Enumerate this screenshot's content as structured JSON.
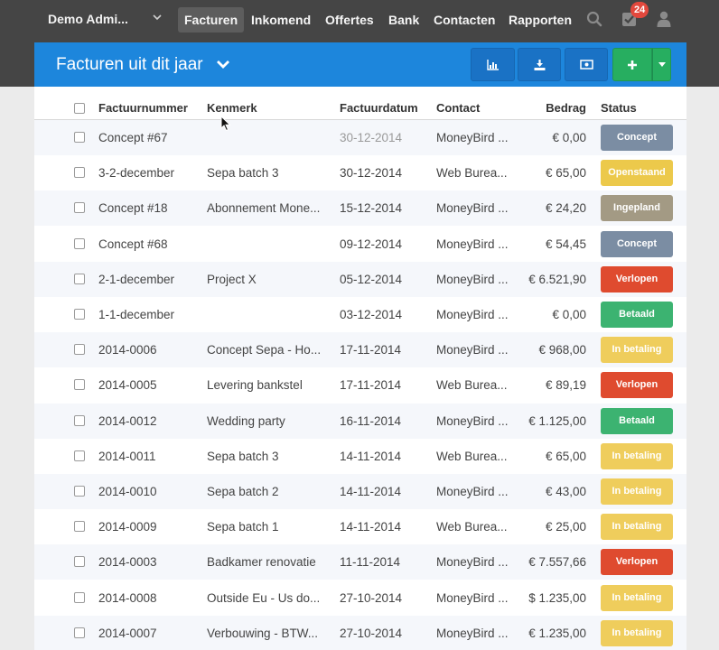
{
  "nav": {
    "admin_label": "Demo Admi...",
    "items": [
      {
        "label": "Facturen",
        "active": true
      },
      {
        "label": "Inkomend"
      },
      {
        "label": "Offertes"
      },
      {
        "label": "Bank"
      },
      {
        "label": "Contacten"
      },
      {
        "label": "Rapporten"
      }
    ],
    "notification_count": "24",
    "icons": [
      "search-icon",
      "check-square-icon",
      "user-icon"
    ]
  },
  "panel": {
    "title": "Facturen uit dit jaar",
    "toolbar_icons": [
      "chart-icon",
      "download-icon",
      "money-icon",
      "plus-icon",
      "caret-down-icon"
    ]
  },
  "table": {
    "headers": [
      "Factuurnummer",
      "Kenmerk",
      "Factuurdatum",
      "Contact",
      "Bedrag",
      "Status"
    ],
    "rows": [
      {
        "number": "Concept #67",
        "reference": "",
        "date": "30-12-2014",
        "contact": "MoneyBird ...",
        "amount": "€ 0,00",
        "status": "Concept"
      },
      {
        "number": "3-2-december",
        "reference": "Sepa batch 3",
        "date": "30-12-2014",
        "contact": "Web Burea...",
        "amount": "€ 65,00",
        "status": "Openstaand"
      },
      {
        "number": "Concept #18",
        "reference": "Abonnement Mone...",
        "date": "15-12-2014",
        "contact": "MoneyBird ...",
        "amount": "€ 24,20",
        "status": "Ingepland"
      },
      {
        "number": "Concept #68",
        "reference": "",
        "date": "09-12-2014",
        "contact": "MoneyBird ...",
        "amount": "€ 54,45",
        "status": "Concept"
      },
      {
        "number": "2-1-december",
        "reference": "Project X",
        "date": "05-12-2014",
        "contact": "MoneyBird ...",
        "amount": "€ 6.521,90",
        "status": "Verlopen"
      },
      {
        "number": "1-1-december",
        "reference": "",
        "date": "03-12-2014",
        "contact": "MoneyBird ...",
        "amount": "€ 0,00",
        "status": "Betaald"
      },
      {
        "number": "2014-0006",
        "reference": "Concept Sepa - Ho...",
        "date": "17-11-2014",
        "contact": "MoneyBird ...",
        "amount": "€ 968,00",
        "status": "In betaling"
      },
      {
        "number": "2014-0005",
        "reference": "Levering bankstel",
        "date": "17-11-2014",
        "contact": "Web Burea...",
        "amount": "€ 89,19",
        "status": "Verlopen"
      },
      {
        "number": "2014-0012",
        "reference": "Wedding party",
        "date": "16-11-2014",
        "contact": "MoneyBird ...",
        "amount": "€ 1.125,00",
        "status": "Betaald"
      },
      {
        "number": "2014-0011",
        "reference": "Sepa batch 3",
        "date": "14-11-2014",
        "contact": "Web Burea...",
        "amount": "€ 65,00",
        "status": "In betaling"
      },
      {
        "number": "2014-0010",
        "reference": "Sepa batch 2",
        "date": "14-11-2014",
        "contact": "MoneyBird ...",
        "amount": "€ 43,00",
        "status": "In betaling"
      },
      {
        "number": "2014-0009",
        "reference": "Sepa batch 1",
        "date": "14-11-2014",
        "contact": "Web Burea...",
        "amount": "€ 25,00",
        "status": "In betaling"
      },
      {
        "number": "2014-0003",
        "reference": "Badkamer renovatie",
        "date": "11-11-2014",
        "contact": "MoneyBird ...",
        "amount": "€ 7.557,66",
        "status": "Verlopen"
      },
      {
        "number": "2014-0008",
        "reference": "Outside Eu - Us do...",
        "date": "27-10-2014",
        "contact": "MoneyBird ...",
        "amount": "$ 1.235,00",
        "status": "In betaling"
      },
      {
        "number": "2014-0007",
        "reference": "Verbouwing - BTW...",
        "date": "27-10-2014",
        "contact": "MoneyBird ...",
        "amount": "€ 1.235,00",
        "status": "In betaling"
      }
    ]
  },
  "status_colors": {
    "Concept": "#7b8da3",
    "Openstaand": "#ecc94b",
    "Ingepland": "#a39a84",
    "Verlopen": "#df4b2f",
    "Betaald": "#3cb371",
    "In betaling": "#efcd5c"
  }
}
